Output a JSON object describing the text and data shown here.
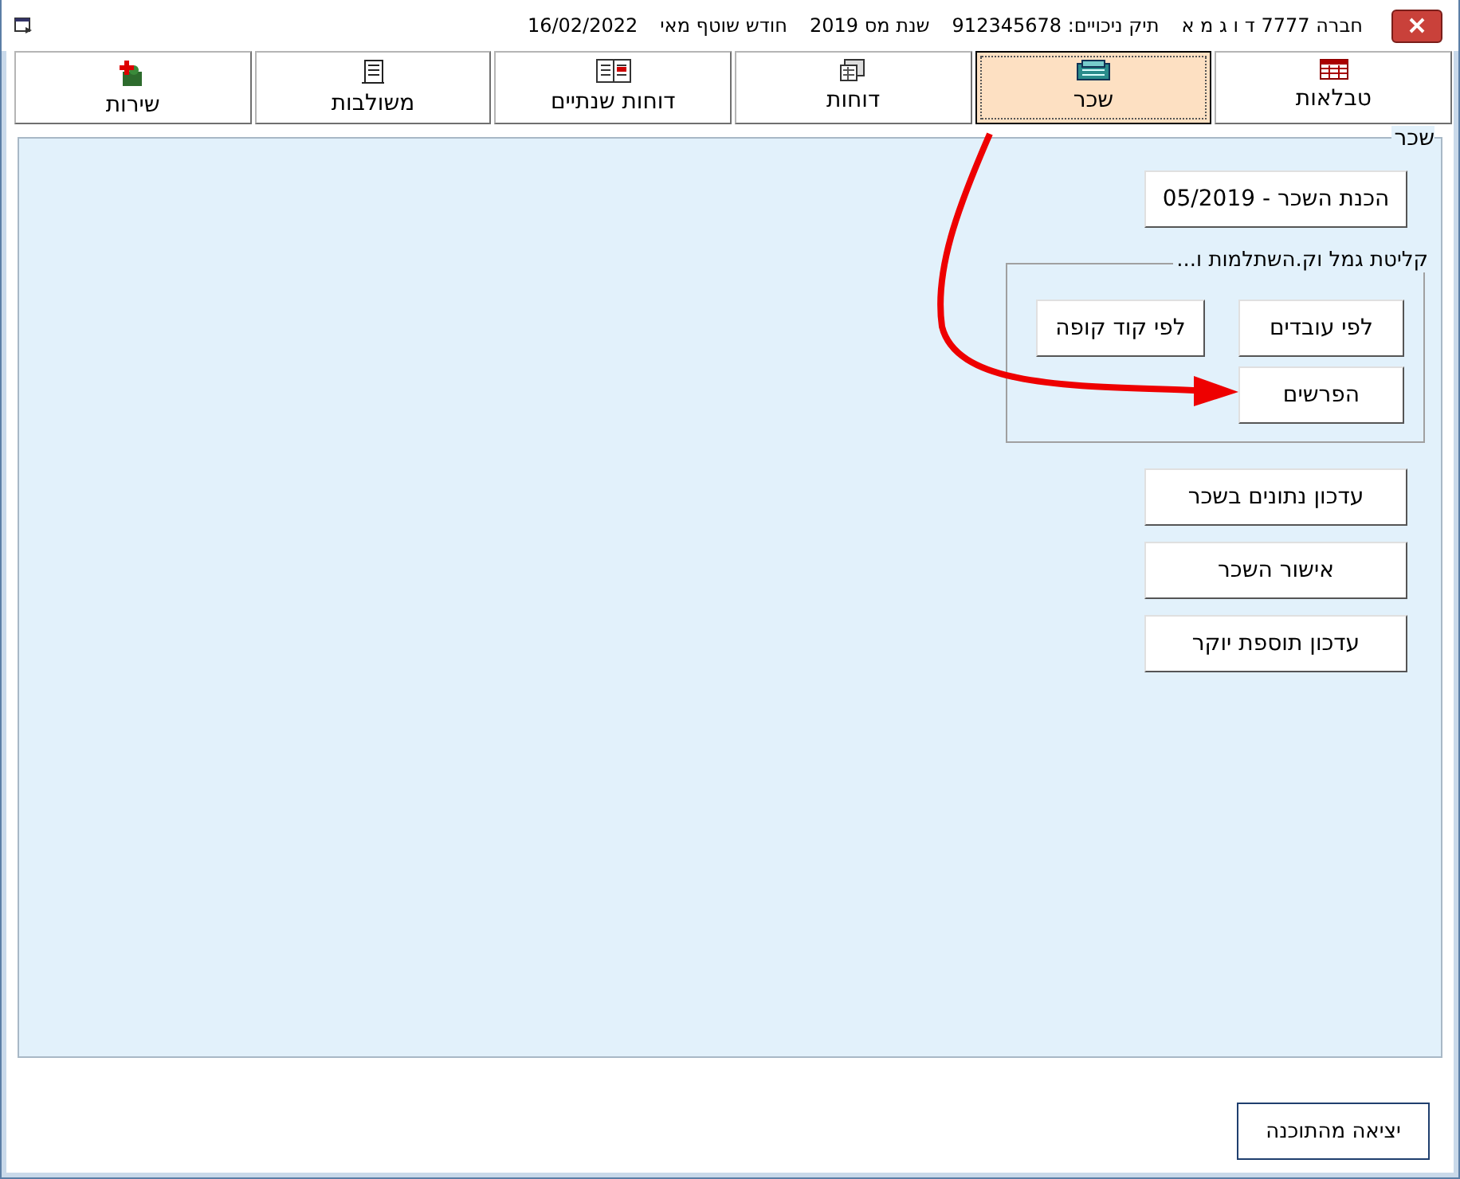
{
  "window": {
    "title_parts": [
      "חברה 7777 ד ו ג מ א",
      "תיק ניכויים: 912345678",
      "שנת מס 2019",
      "חודש שוטף מאי",
      "16/02/2022"
    ]
  },
  "tabs": [
    {
      "label": "טבלאות",
      "selected": false
    },
    {
      "label": "שכר",
      "selected": true
    },
    {
      "label": "דוחות",
      "selected": false
    },
    {
      "label": "דוחות שנתיים",
      "selected": false
    },
    {
      "label": "משולבות",
      "selected": false
    },
    {
      "label": "שירות",
      "selected": false
    }
  ],
  "panel": {
    "title": "שכר",
    "prepare_button": "הכנת השכר - 05/2019",
    "group": {
      "title": "קליטת גמל וק.השתלמות ו...",
      "buttons": [
        "לפי עובדים",
        "לפי קוד קופה",
        "הפרשים"
      ]
    },
    "buttons": [
      "עדכון נתונים בשכר",
      "אישור השכר",
      "עדכון תוספת יוקר"
    ]
  },
  "exit_button": "יציאה מהתוכנה"
}
